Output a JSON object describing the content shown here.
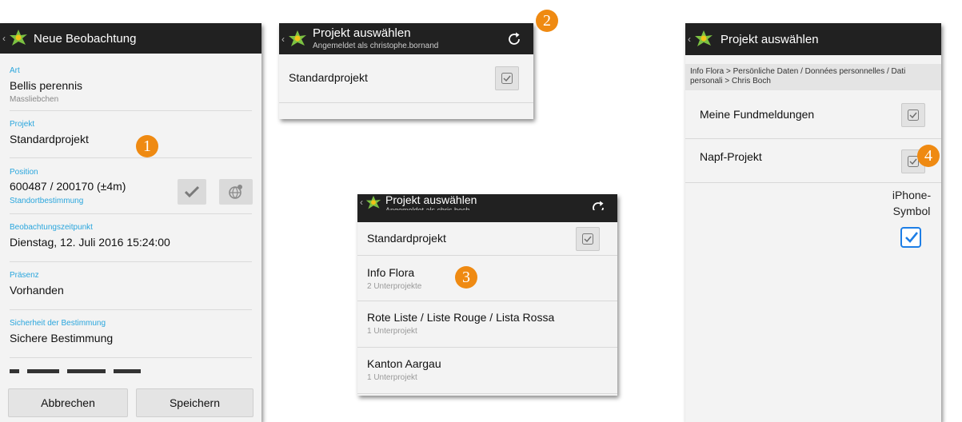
{
  "screen1": {
    "title": "Neue Beobachtung",
    "fields": [
      {
        "label": "Art",
        "value": "Bellis perennis",
        "sub": "Massliebchen"
      },
      {
        "label": "Projekt",
        "value": "Standardprojekt"
      },
      {
        "label": "Position",
        "value": "600487 / 200170 (±4m)",
        "sub": "Standortbestimmung"
      },
      {
        "label": "Beobachtungszeitpunkt",
        "value": "Dienstag, 12. Juli 2016 15:24:00"
      },
      {
        "label": "Präsenz",
        "value": "Vorhanden"
      },
      {
        "label": "Sicherheit der Bestimmung",
        "value": "Sichere Bestimmung"
      }
    ],
    "cancel_label": "Abbrechen",
    "save_label": "Speichern",
    "badge": "1"
  },
  "screen2": {
    "title": "Projekt auswählen",
    "subtitle": "Angemeldet als christophe.bornand",
    "rows": [
      {
        "title": "Standardprojekt"
      }
    ],
    "badge": "2"
  },
  "screen3": {
    "title": "Projekt auswählen",
    "subtitle": "Angemeldet als chris.boch",
    "rows": [
      {
        "title": "Standardprojekt"
      },
      {
        "title": "Info Flora",
        "sub": "2 Unterprojekte"
      },
      {
        "title": "Rote Liste / Liste Rouge / Lista Rossa",
        "sub": "1 Unterprojekt"
      },
      {
        "title": "Kanton Aargau",
        "sub": "1 Unterprojekt"
      }
    ],
    "badge": "3"
  },
  "screen4": {
    "title": "Projekt auswählen",
    "breadcrumb": "Info Flora > Persönliche Daten / Données personnelles / Dati personali > Chris Boch",
    "rows": [
      {
        "title": "Meine Fundmeldungen"
      },
      {
        "title": "Napf-Projekt"
      }
    ],
    "badge": "4",
    "annotation_line1": "iPhone-",
    "annotation_line2": "Symbol"
  },
  "colors": {
    "actionbar": "#212121",
    "label_blue": "#2aa6dd",
    "badge_orange": "#ef8a12",
    "ios_blue": "#1d7ee6"
  }
}
